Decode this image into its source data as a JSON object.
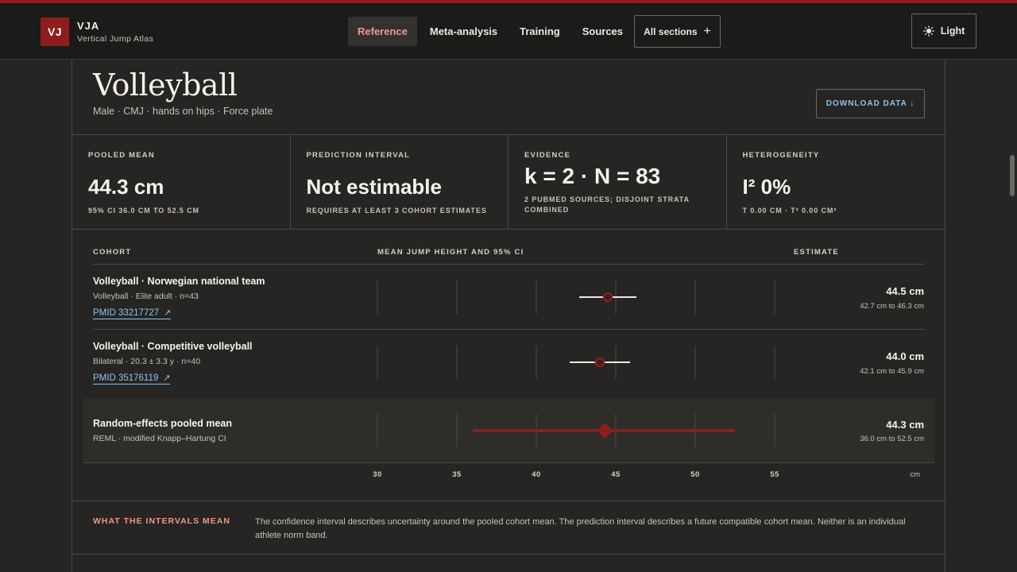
{
  "header": {
    "logo_text": "VJ",
    "brand_name": "VJA",
    "brand_sub": "Vertical Jump Atlas",
    "nav": [
      {
        "label": "Reference",
        "active": true
      },
      {
        "label": "Meta-analysis",
        "active": false
      },
      {
        "label": "Training",
        "active": false
      },
      {
        "label": "Sources",
        "active": false
      }
    ],
    "all_sections_label": "All sections",
    "all_sections_icon": "plus-icon",
    "theme_label": "Light",
    "theme_icon": "sun-icon"
  },
  "page": {
    "title": "Volleyball",
    "subtitle": "Male · CMJ · hands on hips · Force plate",
    "download_label": "DOWNLOAD DATA ↓"
  },
  "stats": [
    {
      "label": "POOLED MEAN",
      "value": "44.3 cm",
      "note": "95% CI 36.0 CM TO 52.5 CM"
    },
    {
      "label": "PREDICTION INTERVAL",
      "value": "Not estimable",
      "note": "REQUIRES AT LEAST 3 COHORT ESTIMATES"
    },
    {
      "label": "EVIDENCE",
      "value": "k = 2 · N = 83",
      "note": "2 PUBMED SOURCES; DISJOINT STRATA COMBINED"
    },
    {
      "label": "HETEROGENEITY",
      "value": "I² 0%",
      "note": "T 0.00 CM · T² 0.00 CM²"
    }
  ],
  "table": {
    "col_cohort": "COHORT",
    "col_plot": "MEAN JUMP HEIGHT AND 95% CI",
    "col_estimate": "ESTIMATE",
    "rows": [
      {
        "title": "Volleyball · Norwegian national team",
        "sub": "Volleyball · Elite adult · n=43",
        "link": "PMID 33217727",
        "estimate": "44.5 cm",
        "ci": "42.7 cm to 46.3 cm"
      },
      {
        "title": "Volleyball · Competitive volleyball",
        "sub": "Bilateral · 20.3 ± 3.3 y · n=40",
        "link": "PMID 35176119",
        "estimate": "44.0 cm",
        "ci": "42.1 cm to 45.9 cm"
      }
    ],
    "pooled": {
      "title": "Random-effects pooled mean",
      "sub": "REML · modified Knapp–Hartung CI",
      "estimate": "44.3 cm",
      "ci": "36.0 cm to 52.5 cm"
    },
    "unit": "cm",
    "link_icon": "external-link-icon"
  },
  "chart_data": {
    "type": "scatter",
    "title": "",
    "xlabel": "cm",
    "xlim": [
      28,
      57
    ],
    "ticks": [
      30,
      35,
      40,
      45,
      50,
      55
    ],
    "series": [
      {
        "name": "Volleyball · Norwegian national team",
        "mean": 44.5,
        "lo": 42.7,
        "hi": 46.3
      },
      {
        "name": "Volleyball · Competitive volleyball",
        "mean": 44.0,
        "lo": 42.1,
        "hi": 45.9
      },
      {
        "name": "Random-effects pooled mean",
        "mean": 44.3,
        "lo": 36.0,
        "hi": 52.5
      }
    ],
    "colors": {
      "accent": "#8f1d1d",
      "ci_line": "#ece8e1",
      "grid": "#4b4a46"
    }
  },
  "note": {
    "label": "WHAT THE INTERVALS MEAN",
    "text": "The confidence interval describes uncertainty around the pooled cohort mean. The prediction interval describes a future compatible cohort mean. Neither is an individual athlete norm band."
  }
}
